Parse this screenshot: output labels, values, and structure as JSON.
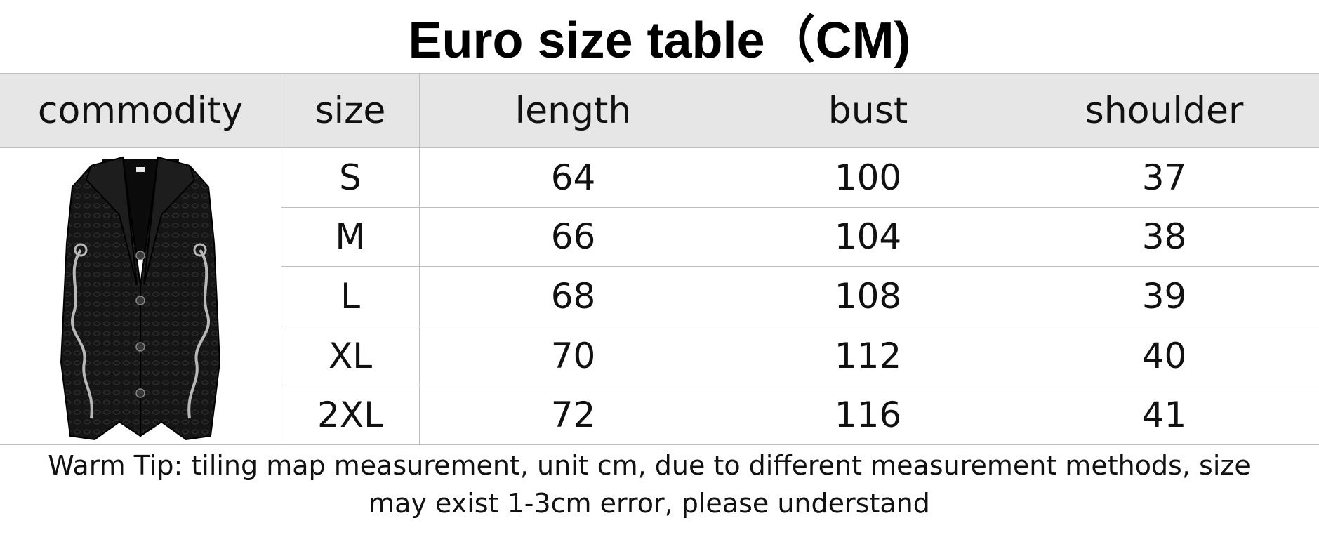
{
  "title": "Euro size table（CM)",
  "table": {
    "headers": [
      "commodity",
      "size",
      "length",
      "bust",
      "shoulder"
    ],
    "rows": [
      [
        "S",
        "64",
        "100",
        "37"
      ],
      [
        "M",
        "66",
        "104",
        "38"
      ],
      [
        "L",
        "68",
        "108",
        "39"
      ],
      [
        "XL",
        "70",
        "112",
        "40"
      ],
      [
        "2XL",
        "72",
        "116",
        "41"
      ]
    ]
  },
  "product_image": "black-vest-icon",
  "tip": "Warm Tip: tiling map measurement, unit cm, due to different measurement methods, size may exist 1-3cm error, please understand"
}
